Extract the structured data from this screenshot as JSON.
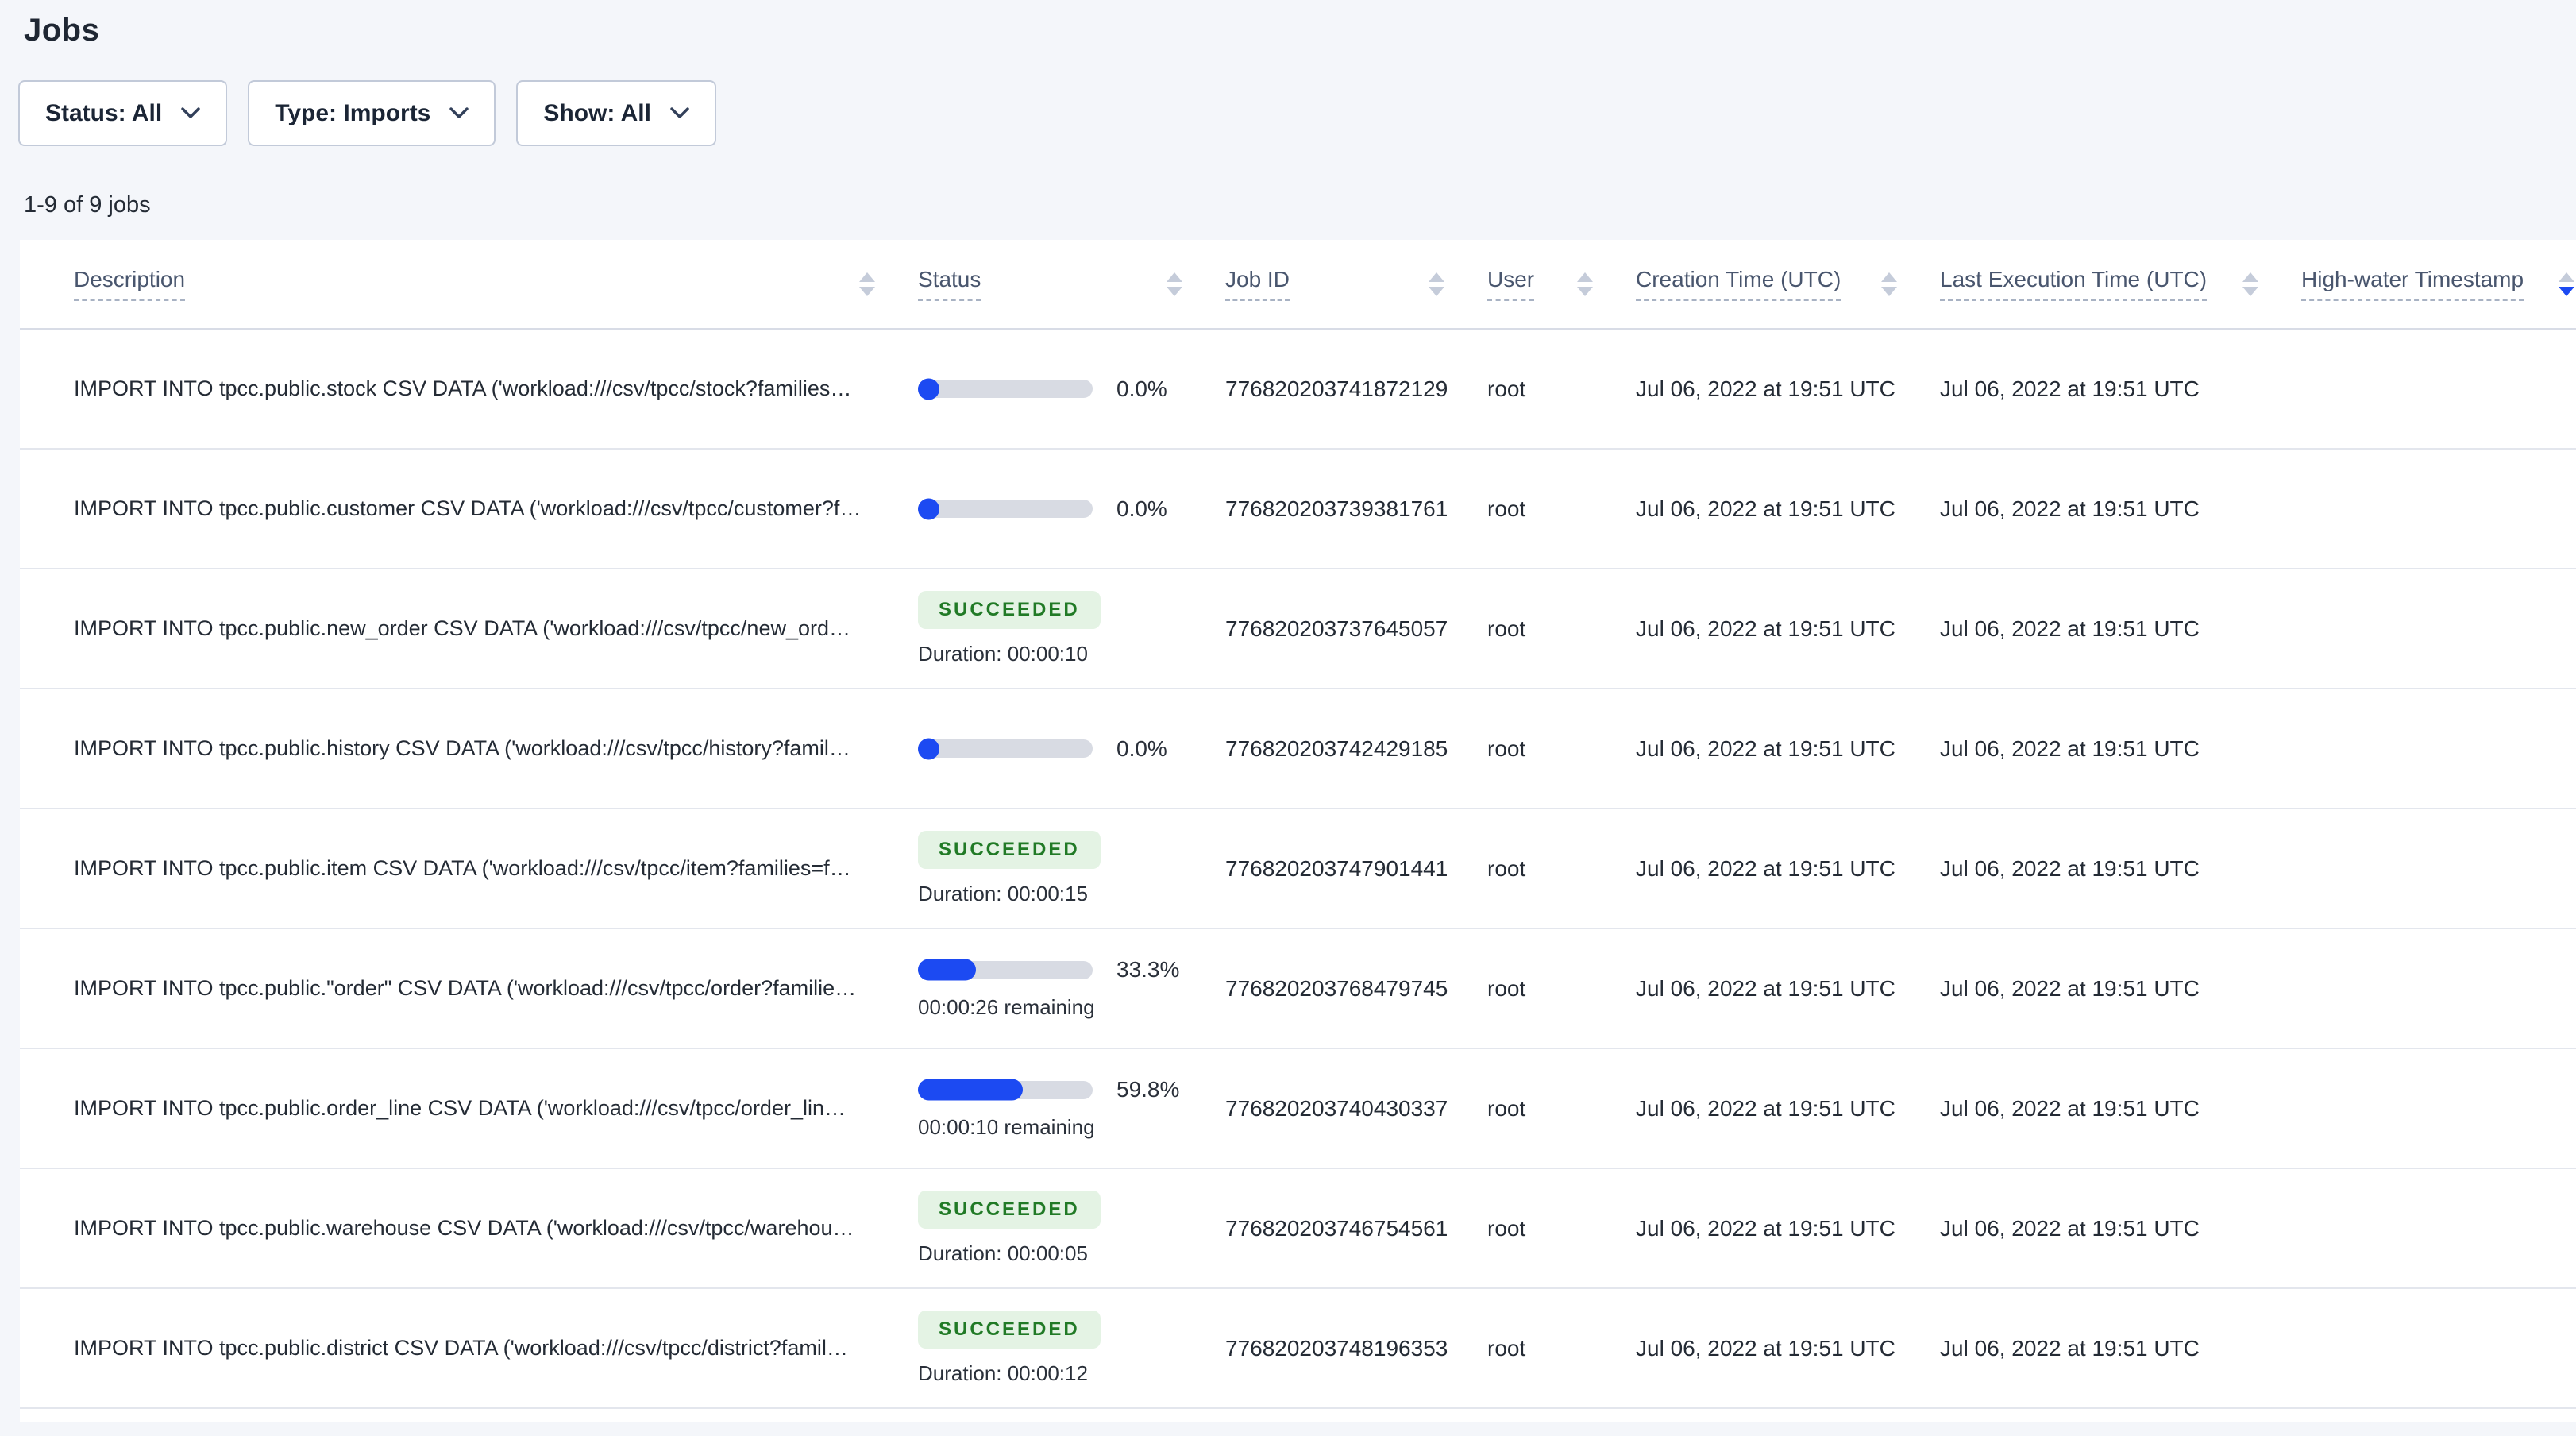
{
  "page": {
    "title": "Jobs",
    "jobs_count": "1-9 of 9 jobs"
  },
  "filters": {
    "status": {
      "label": "Status: All"
    },
    "type": {
      "label": "Type: Imports"
    },
    "show": {
      "label": "Show: All"
    }
  },
  "colors": {
    "accent_blue": "#1c4af2",
    "progress_track": "#d8dbe3",
    "success_bg": "#e4f3e4",
    "success_text": "#217a26",
    "page_bg": "#f4f6fa"
  },
  "table": {
    "columns": [
      {
        "label": "Description"
      },
      {
        "label": "Status"
      },
      {
        "label": "Job ID"
      },
      {
        "label": "User"
      },
      {
        "label": "Creation Time (UTC)"
      },
      {
        "label": "Last Execution Time (UTC)"
      },
      {
        "label": "High-water Timestamp"
      }
    ],
    "sort": {
      "active_column": "High-water Timestamp",
      "direction": "desc"
    },
    "rows": [
      {
        "description": "IMPORT INTO tpcc.public.stock CSV DATA ('workload:///csv/tpcc/stock?families…",
        "status": {
          "type": "progress",
          "percent": 0,
          "percent_label": "0.0%"
        },
        "job_id": "776820203741872129",
        "user": "root",
        "creation_time": "Jul 06, 2022 at 19:51 UTC",
        "last_execution_time": "Jul 06, 2022 at 19:51 UTC",
        "high_water": ""
      },
      {
        "description": "IMPORT INTO tpcc.public.customer CSV DATA ('workload:///csv/tpcc/customer?f…",
        "status": {
          "type": "progress",
          "percent": 0,
          "percent_label": "0.0%"
        },
        "job_id": "776820203739381761",
        "user": "root",
        "creation_time": "Jul 06, 2022 at 19:51 UTC",
        "last_execution_time": "Jul 06, 2022 at 19:51 UTC",
        "high_water": ""
      },
      {
        "description": "IMPORT INTO tpcc.public.new_order CSV DATA ('workload:///csv/tpcc/new_ord…",
        "status": {
          "type": "succeeded",
          "badge": "SUCCEEDED",
          "duration": "Duration: 00:00:10"
        },
        "job_id": "776820203737645057",
        "user": "root",
        "creation_time": "Jul 06, 2022 at 19:51 UTC",
        "last_execution_time": "Jul 06, 2022 at 19:51 UTC",
        "high_water": ""
      },
      {
        "description": "IMPORT INTO tpcc.public.history CSV DATA ('workload:///csv/tpcc/history?famil…",
        "status": {
          "type": "progress",
          "percent": 0,
          "percent_label": "0.0%"
        },
        "job_id": "776820203742429185",
        "user": "root",
        "creation_time": "Jul 06, 2022 at 19:51 UTC",
        "last_execution_time": "Jul 06, 2022 at 19:51 UTC",
        "high_water": ""
      },
      {
        "description": "IMPORT INTO tpcc.public.item CSV DATA ('workload:///csv/tpcc/item?families=f…",
        "status": {
          "type": "succeeded",
          "badge": "SUCCEEDED",
          "duration": "Duration: 00:00:15"
        },
        "job_id": "776820203747901441",
        "user": "root",
        "creation_time": "Jul 06, 2022 at 19:51 UTC",
        "last_execution_time": "Jul 06, 2022 at 19:51 UTC",
        "high_water": ""
      },
      {
        "description": "IMPORT INTO tpcc.public.\"order\" CSV DATA ('workload:///csv/tpcc/order?familie…",
        "status": {
          "type": "progress",
          "percent": 33.3,
          "percent_label": "33.3%",
          "remaining": "00:00:26 remaining"
        },
        "job_id": "776820203768479745",
        "user": "root",
        "creation_time": "Jul 06, 2022 at 19:51 UTC",
        "last_execution_time": "Jul 06, 2022 at 19:51 UTC",
        "high_water": ""
      },
      {
        "description": "IMPORT INTO tpcc.public.order_line CSV DATA ('workload:///csv/tpcc/order_lin…",
        "status": {
          "type": "progress",
          "percent": 59.8,
          "percent_label": "59.8%",
          "remaining": "00:00:10 remaining"
        },
        "job_id": "776820203740430337",
        "user": "root",
        "creation_time": "Jul 06, 2022 at 19:51 UTC",
        "last_execution_time": "Jul 06, 2022 at 19:51 UTC",
        "high_water": ""
      },
      {
        "description": "IMPORT INTO tpcc.public.warehouse CSV DATA ('workload:///csv/tpcc/warehou…",
        "status": {
          "type": "succeeded",
          "badge": "SUCCEEDED",
          "duration": "Duration: 00:00:05"
        },
        "job_id": "776820203746754561",
        "user": "root",
        "creation_time": "Jul 06, 2022 at 19:51 UTC",
        "last_execution_time": "Jul 06, 2022 at 19:51 UTC",
        "high_water": ""
      },
      {
        "description": "IMPORT INTO tpcc.public.district CSV DATA ('workload:///csv/tpcc/district?famil…",
        "status": {
          "type": "succeeded",
          "badge": "SUCCEEDED",
          "duration": "Duration: 00:00:12"
        },
        "job_id": "776820203748196353",
        "user": "root",
        "creation_time": "Jul 06, 2022 at 19:51 UTC",
        "last_execution_time": "Jul 06, 2022 at 19:51 UTC",
        "high_water": ""
      }
    ]
  }
}
